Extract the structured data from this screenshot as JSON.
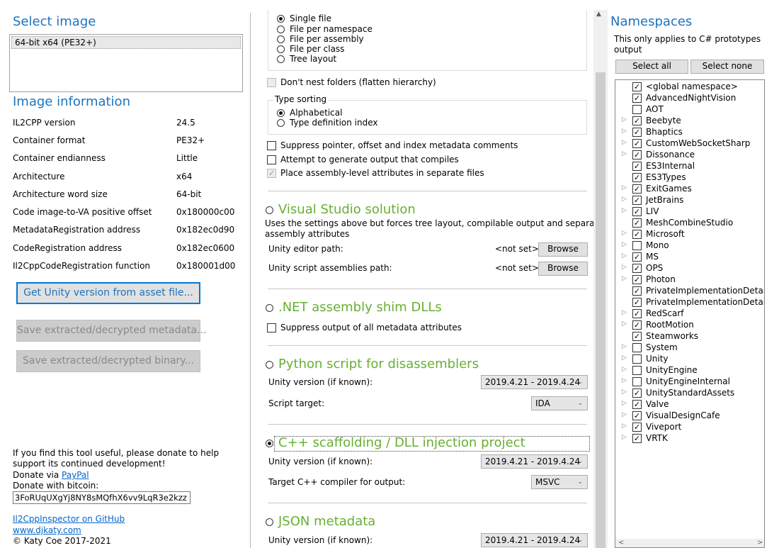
{
  "left": {
    "select_image_header": "Select image",
    "image_list": [
      "64-bit x64 (PE32+)"
    ],
    "image_info_header": "Image information",
    "info_rows": [
      {
        "label": "IL2CPP version",
        "value": "24.5"
      },
      {
        "label": "Container format",
        "value": "PE32+"
      },
      {
        "label": "Container endianness",
        "value": "Little"
      },
      {
        "label": "Architecture",
        "value": "x64"
      },
      {
        "label": "Architecture word size",
        "value": "64-bit"
      },
      {
        "label": "Code image-to-VA positive offset",
        "value": "0x180000c00"
      },
      {
        "label": "MetadataRegistration address",
        "value": "0x182ec0d90"
      },
      {
        "label": "CodeRegistration address",
        "value": "0x182ec0600"
      },
      {
        "label": "Il2CppCodeRegistration function",
        "value": "0x180001d00"
      }
    ],
    "btn_unity_version": "Get Unity version from asset file...",
    "btn_save_metadata": "Save extracted/decrypted metadata...",
    "btn_save_binary": "Save extracted/decrypted binary...",
    "donate_text1": "If you find this tool useful, please donate to help",
    "donate_text2": "support its continued development!",
    "donate_via": "Donate via ",
    "paypal": "PayPal",
    "donate_bitcoin": "Donate with bitcoin:",
    "bitcoin_address": "3FoRUqUXgYj8NY8sMQfhX6vv9LqR3e2kzz",
    "github_link": "Il2CppInspector on GitHub",
    "site_link": "www.djkaty.com",
    "copyright": "© Katy Coe 2017-2021"
  },
  "middle": {
    "layout_options": [
      {
        "label": "Single file",
        "selected": true
      },
      {
        "label": "File per namespace",
        "selected": false
      },
      {
        "label": "File per assembly",
        "selected": false
      },
      {
        "label": "File per class",
        "selected": false
      },
      {
        "label": "Tree layout",
        "selected": false
      }
    ],
    "dont_nest": "Don't nest folders (flatten hierarchy)",
    "type_sorting_label": "Type sorting",
    "sort_options": [
      {
        "label": "Alphabetical",
        "selected": true
      },
      {
        "label": "Type definition index",
        "selected": false
      }
    ],
    "cs_options": [
      {
        "label": "Suppress pointer, offset and index metadata comments",
        "checked": false,
        "disabled": false
      },
      {
        "label": "Attempt to generate output that compiles",
        "checked": false,
        "disabled": false
      },
      {
        "label": "Place assembly-level attributes in separate files",
        "checked": true,
        "disabled": true
      }
    ],
    "vs": {
      "title": "Visual Studio solution",
      "desc1": "Uses the settings above but forces tree layout, compilable output and separate",
      "desc2": "assembly attributes",
      "editor_label": "Unity editor path:",
      "editor_value": "<not set>",
      "assemblies_label": "Unity script assemblies path:",
      "assemblies_value": "<not set>",
      "browse": "Browse"
    },
    "shim": {
      "title": ".NET assembly shim DLLs",
      "suppress": "Suppress output of all metadata attributes"
    },
    "python": {
      "title": "Python script for disassemblers",
      "unity_label": "Unity version (if known):",
      "unity_value": "2019.4.21 - 2019.4.24",
      "target_label": "Script target:",
      "target_value": "IDA"
    },
    "cpp": {
      "title": "C++ scaffolding / DLL injection project",
      "unity_label": "Unity version (if known):",
      "unity_value": "2019.4.21 - 2019.4.24",
      "compiler_label": "Target C++ compiler for output:",
      "compiler_value": "MSVC"
    },
    "json": {
      "title": "JSON metadata",
      "unity_label": "Unity version (if known):",
      "unity_value": "2019.4.21 - 2019.4.24"
    }
  },
  "right": {
    "header": "Namespaces",
    "note1": "This only applies to C# prototypes",
    "note2": "output",
    "select_all": "Select all",
    "select_none": "Select none",
    "namespaces": [
      {
        "name": "<global namespace>",
        "checked": true,
        "expandable": false
      },
      {
        "name": "AdvancedNightVision",
        "checked": true,
        "expandable": false
      },
      {
        "name": "AOT",
        "checked": false,
        "expandable": false
      },
      {
        "name": "Beebyte",
        "checked": true,
        "expandable": true
      },
      {
        "name": "Bhaptics",
        "checked": true,
        "expandable": true
      },
      {
        "name": "CustomWebSocketSharp",
        "checked": true,
        "expandable": true
      },
      {
        "name": "Dissonance",
        "checked": true,
        "expandable": true
      },
      {
        "name": "ES3Internal",
        "checked": true,
        "expandable": false
      },
      {
        "name": "ES3Types",
        "checked": true,
        "expandable": false
      },
      {
        "name": "ExitGames",
        "checked": true,
        "expandable": true
      },
      {
        "name": "JetBrains",
        "checked": true,
        "expandable": true
      },
      {
        "name": "LIV",
        "checked": true,
        "expandable": true
      },
      {
        "name": "MeshCombineStudio",
        "checked": true,
        "expandable": false
      },
      {
        "name": "Microsoft",
        "checked": true,
        "expandable": true
      },
      {
        "name": "Mono",
        "checked": false,
        "expandable": true
      },
      {
        "name": "MS",
        "checked": true,
        "expandable": true
      },
      {
        "name": "OPS",
        "checked": true,
        "expandable": true
      },
      {
        "name": "Photon",
        "checked": true,
        "expandable": true
      },
      {
        "name": "PrivateImplementationDetails",
        "checked": true,
        "expandable": false
      },
      {
        "name": "PrivateImplementationDetails",
        "checked": true,
        "expandable": false
      },
      {
        "name": "RedScarf",
        "checked": true,
        "expandable": true
      },
      {
        "name": "RootMotion",
        "checked": true,
        "expandable": true
      },
      {
        "name": "Steamworks",
        "checked": true,
        "expandable": false
      },
      {
        "name": "System",
        "checked": false,
        "expandable": true
      },
      {
        "name": "Unity",
        "checked": false,
        "expandable": true
      },
      {
        "name": "UnityEngine",
        "checked": false,
        "expandable": true
      },
      {
        "name": "UnityEngineInternal",
        "checked": false,
        "expandable": true
      },
      {
        "name": "UnityStandardAssets",
        "checked": true,
        "expandable": true
      },
      {
        "name": "Valve",
        "checked": true,
        "expandable": true
      },
      {
        "name": "VisualDesignCafe",
        "checked": true,
        "expandable": true
      },
      {
        "name": "Viveport",
        "checked": true,
        "expandable": true
      },
      {
        "name": "VRTK",
        "checked": true,
        "expandable": true
      }
    ]
  }
}
